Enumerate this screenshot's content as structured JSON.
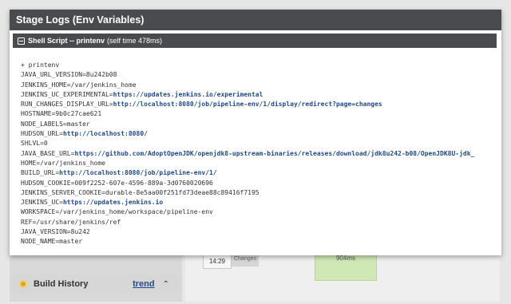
{
  "modal": {
    "title": "Stage Logs (Env Variables)",
    "step": {
      "name": "Shell Script -- printenv",
      "time": "(self time 478ms)"
    },
    "log_lines": [
      {
        "text": "+ printenv",
        "key": "",
        "value": "",
        "link": false
      },
      {
        "text": "",
        "key": "JAVA_URL_VERSION=",
        "value": "8u242b08",
        "link": false
      },
      {
        "text": "",
        "key": "JENKINS_HOME=",
        "value": "/var/jenkins_home",
        "link": false
      },
      {
        "text": "",
        "key": "JENKINS_UC_EXPERIMENTAL=",
        "value": "https://updates.jenkins.io/experimental",
        "link": true
      },
      {
        "text": "",
        "key": "RUN_CHANGES_DISPLAY_URL=",
        "value": "http://localhost:8080/job/pipeline-env/1/display/redirect?page=changes",
        "link": true
      },
      {
        "text": "",
        "key": "HOSTNAME=",
        "value": "9b0c27cae621",
        "link": false
      },
      {
        "text": "",
        "key": "NODE_LABELS=",
        "value": "master",
        "link": false
      },
      {
        "text": "",
        "key": "HUDSON_URL=",
        "value": "http://localhost:8080/",
        "link": true
      },
      {
        "text": "",
        "key": "SHLVL=",
        "value": "0",
        "link": false
      },
      {
        "text": "",
        "key": "JAVA_BASE_URL=",
        "value": "https://github.com/AdoptOpenJDK/openjdk8-upstream-binaries/releases/download/jdk8u242-b08/OpenJDK8U-jdk_",
        "link": true
      },
      {
        "text": "",
        "key": "HOME=",
        "value": "/var/jenkins_home",
        "link": false
      },
      {
        "text": "",
        "key": "BUILD_URL=",
        "value": "http://localhost:8080/job/pipeline-env/1/",
        "link": true
      },
      {
        "text": "",
        "key": "HUDSON_COOKIE=",
        "value": "009f2252-607e-4596-889a-3d0760020696",
        "link": false
      },
      {
        "text": "",
        "key": "JENKINS_SERVER_COOKIE=",
        "value": "durable-8e5aa00f251fd73deae88c89416f7195",
        "link": false
      },
      {
        "text": "",
        "key": "JENKINS_UC=",
        "value": "https://updates.jenkins.io",
        "link": true
      },
      {
        "text": "",
        "key": "WORKSPACE=",
        "value": "/var/jenkins_home/workspace/pipeline-env",
        "link": false
      },
      {
        "text": "",
        "key": "REF=",
        "value": "/usr/share/jenkins/ref",
        "link": false
      },
      {
        "text": "",
        "key": "JAVA_VERSION=",
        "value": "8u242",
        "link": false
      },
      {
        "text": "",
        "key": "NODE_NAME=",
        "value": "master",
        "link": false
      }
    ]
  },
  "background": {
    "build_history_label": "Build History",
    "trend_label": "trend",
    "build_time": "14:29",
    "changes_label": "Changes",
    "stage_duration": "904ms"
  },
  "colors": {
    "header_bg": "#4a4b4e",
    "link": "#204a87",
    "stage_success": "#cfe8b5"
  }
}
